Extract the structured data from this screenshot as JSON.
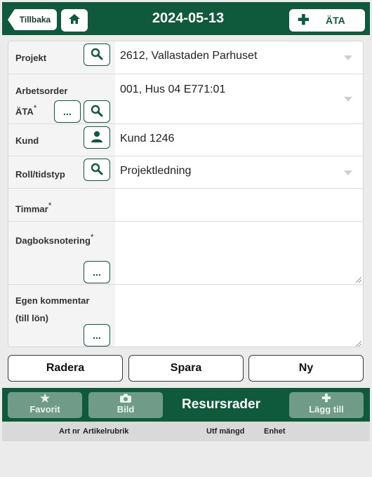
{
  "header": {
    "back_label": "Tillbaka",
    "date": "2024-05-13",
    "ata_label": "ÄTA"
  },
  "form": {
    "projekt": {
      "label": "Projekt",
      "value": "2612, Vallastaden Parhuset"
    },
    "arbetsorder": {
      "label_line1": "Arbetsorder",
      "label_line2": "ÄTA",
      "required": "*",
      "value": "001, Hus 04 E771:01",
      "dots": "..."
    },
    "kund": {
      "label": "Kund",
      "value": "Kund 1246"
    },
    "roll": {
      "label": "Roll/tidstyp",
      "value": "Projektledning"
    },
    "timmar": {
      "label": "Timmar",
      "required": "*",
      "value": ""
    },
    "dagbok": {
      "label": "Dagboksnotering",
      "required": "*",
      "value": "",
      "dots": "..."
    },
    "kommentar": {
      "label_line1": "Egen kommentar",
      "label_line2": "(till lön)",
      "value": "",
      "dots": "..."
    }
  },
  "actions": {
    "delete": "Radera",
    "save": "Spara",
    "new": "Ny"
  },
  "resources": {
    "favorite": "Favorit",
    "photo": "Bild",
    "title": "Resursrader",
    "add": "Lägg till",
    "columns": [
      "Art nr",
      "Artikelrubrik",
      "Utf mängd",
      "Enhet"
    ]
  },
  "colors": {
    "brand": "#0f5a3c",
    "muted_button": "#6f9b88",
    "background": "#ebebeb"
  },
  "icons": [
    "home-icon",
    "search-icon",
    "person-icon",
    "plus-icon",
    "star-icon",
    "camera-icon"
  ]
}
